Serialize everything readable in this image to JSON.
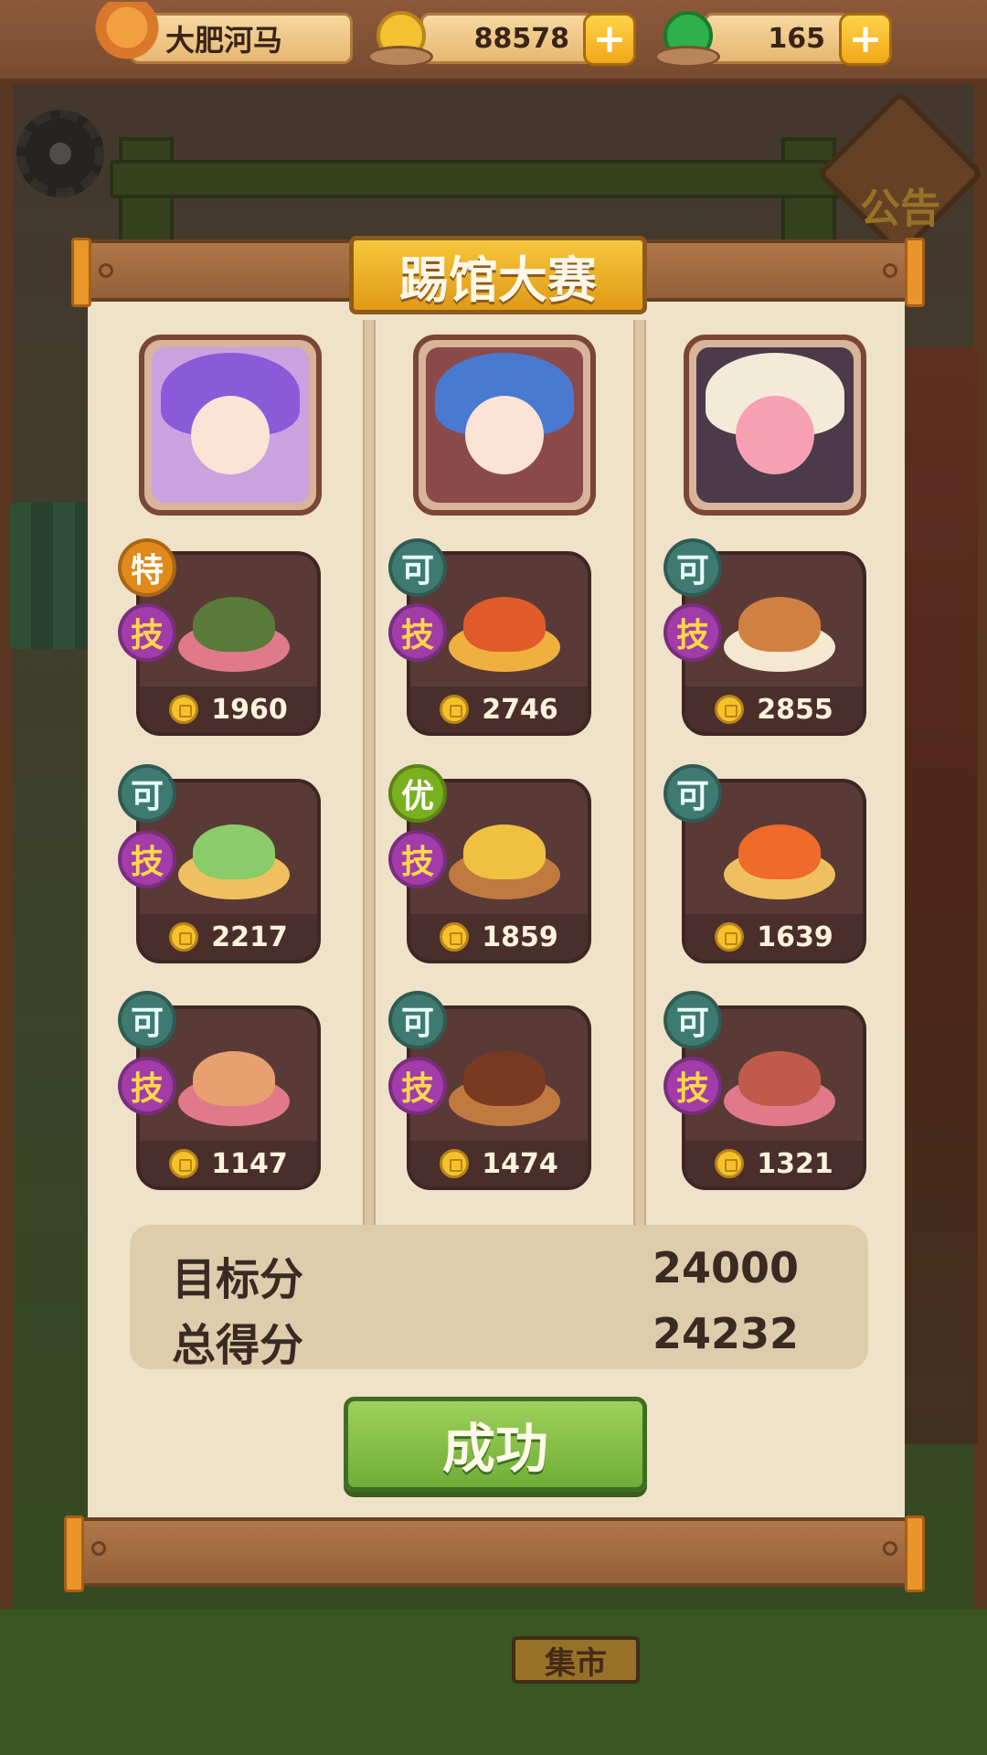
{
  "hud": {
    "player_name": "大肥河马",
    "coins": "88578",
    "jade": "165",
    "add_label": "+"
  },
  "scene": {
    "notice": "公告",
    "market_sign": "集市"
  },
  "contest": {
    "title": "踢馆大赛",
    "columns": [
      {
        "portrait_name": "purple-haired-chef",
        "dishes": [
          {
            "rank": "特",
            "skill": "技",
            "price": "1960",
            "dish": "noodle-dish"
          },
          {
            "rank": "可",
            "skill": "技",
            "price": "2217",
            "dish": "shrimp-leaf-dish"
          },
          {
            "rank": "可",
            "skill": "技",
            "price": "1147",
            "dish": "seafood-bowl"
          }
        ]
      },
      {
        "portrait_name": "blue-haired-chef",
        "dishes": [
          {
            "rank": "可",
            "skill": "技",
            "price": "2746",
            "dish": "lobster-dish"
          },
          {
            "rank": "优",
            "skill": "技",
            "price": "1859",
            "dish": "omelette-platter"
          },
          {
            "rank": "可",
            "skill": "技",
            "price": "1474",
            "dish": "steak-platter"
          }
        ]
      },
      {
        "portrait_name": "pink-haired-chef",
        "dishes": [
          {
            "rank": "可",
            "skill": "技",
            "price": "2855",
            "dish": "noodle-pot"
          },
          {
            "rank": "可",
            "skill": "",
            "price": "1639",
            "dish": "fish-roe-bowl"
          },
          {
            "rank": "可",
            "skill": "技",
            "price": "1321",
            "dish": "fish-head-soup"
          }
        ]
      }
    ],
    "target_label": "目标分",
    "target_score": "24000",
    "total_label": "总得分",
    "total_score": "24232",
    "result_label": "成功"
  },
  "colors": {
    "rank_ke": "#3f7a70",
    "rank_te": "#e08a1c",
    "rank_you": "#7ab020",
    "skill": "#a23ca8",
    "success_button": "#8cc04a"
  }
}
